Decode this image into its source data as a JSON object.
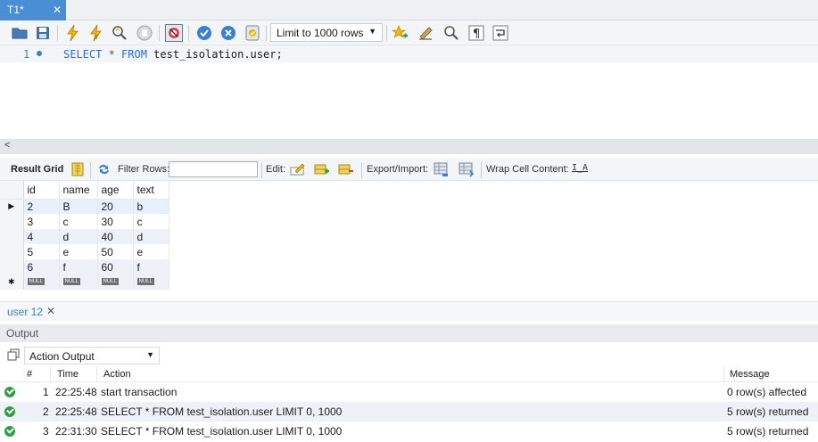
{
  "tab": {
    "title": "T1*",
    "close": "✕"
  },
  "toolbar": {
    "limit_select": {
      "value": "Limit to 1000 rows",
      "arrow": "▼"
    },
    "icons": [
      "open-folder-icon",
      "save-icon",
      "execute-icon",
      "execute-current-icon",
      "explain-icon",
      "stop-icon",
      "toggle-error-icon",
      "commit-icon",
      "rollback-icon",
      "autocommit-icon",
      "add-snippet-icon",
      "beautify-icon",
      "find-icon",
      "invisible-chars-icon",
      "wrap-icon"
    ]
  },
  "editor": {
    "line_number": "1",
    "code": {
      "kw1": "SELECT",
      "star": " * ",
      "kw2": "FROM",
      "ident": " test_isolation.user;"
    }
  },
  "scrollbar": {
    "left_arrow": "<"
  },
  "result_toolbar": {
    "result_grid": "Result Grid",
    "filter_rows": "Filter Rows:",
    "filter_value": "",
    "edit": "Edit:",
    "export_import": "Export/Import:",
    "wrap_cell": "Wrap Cell Content:",
    "wrap_icon_text": "I̲A"
  },
  "grid": {
    "columns": [
      "id",
      "name",
      "age",
      "text"
    ],
    "rows": [
      [
        "2",
        "B",
        "20",
        "b"
      ],
      [
        "3",
        "c",
        "30",
        "c"
      ],
      [
        "4",
        "d",
        "40",
        "d"
      ],
      [
        "5",
        "e",
        "50",
        "e"
      ],
      [
        "6",
        "f",
        "60",
        "f"
      ]
    ],
    "null_label": "NULL",
    "current_row_marker": "▶",
    "new_row_marker": "✱"
  },
  "bottom_tab": {
    "label": "user 12",
    "close": "✕"
  },
  "output": {
    "header": "Output",
    "select_value": "Action Output",
    "select_arrow": "▼",
    "columns": {
      "num": "#",
      "time": "Time",
      "action": "Action",
      "message": "Message"
    },
    "rows": [
      {
        "num": "1",
        "time": "22:25:48",
        "action": "start transaction",
        "message": "0 row(s) affected"
      },
      {
        "num": "2",
        "time": "22:25:48",
        "action": "SELECT * FROM test_isolation.user LIMIT 0, 1000",
        "message": "5 row(s) returned"
      },
      {
        "num": "3",
        "time": "22:31:30",
        "action": "SELECT * FROM test_isolation.user LIMIT 0, 1000",
        "message": "5 row(s) returned"
      }
    ]
  }
}
